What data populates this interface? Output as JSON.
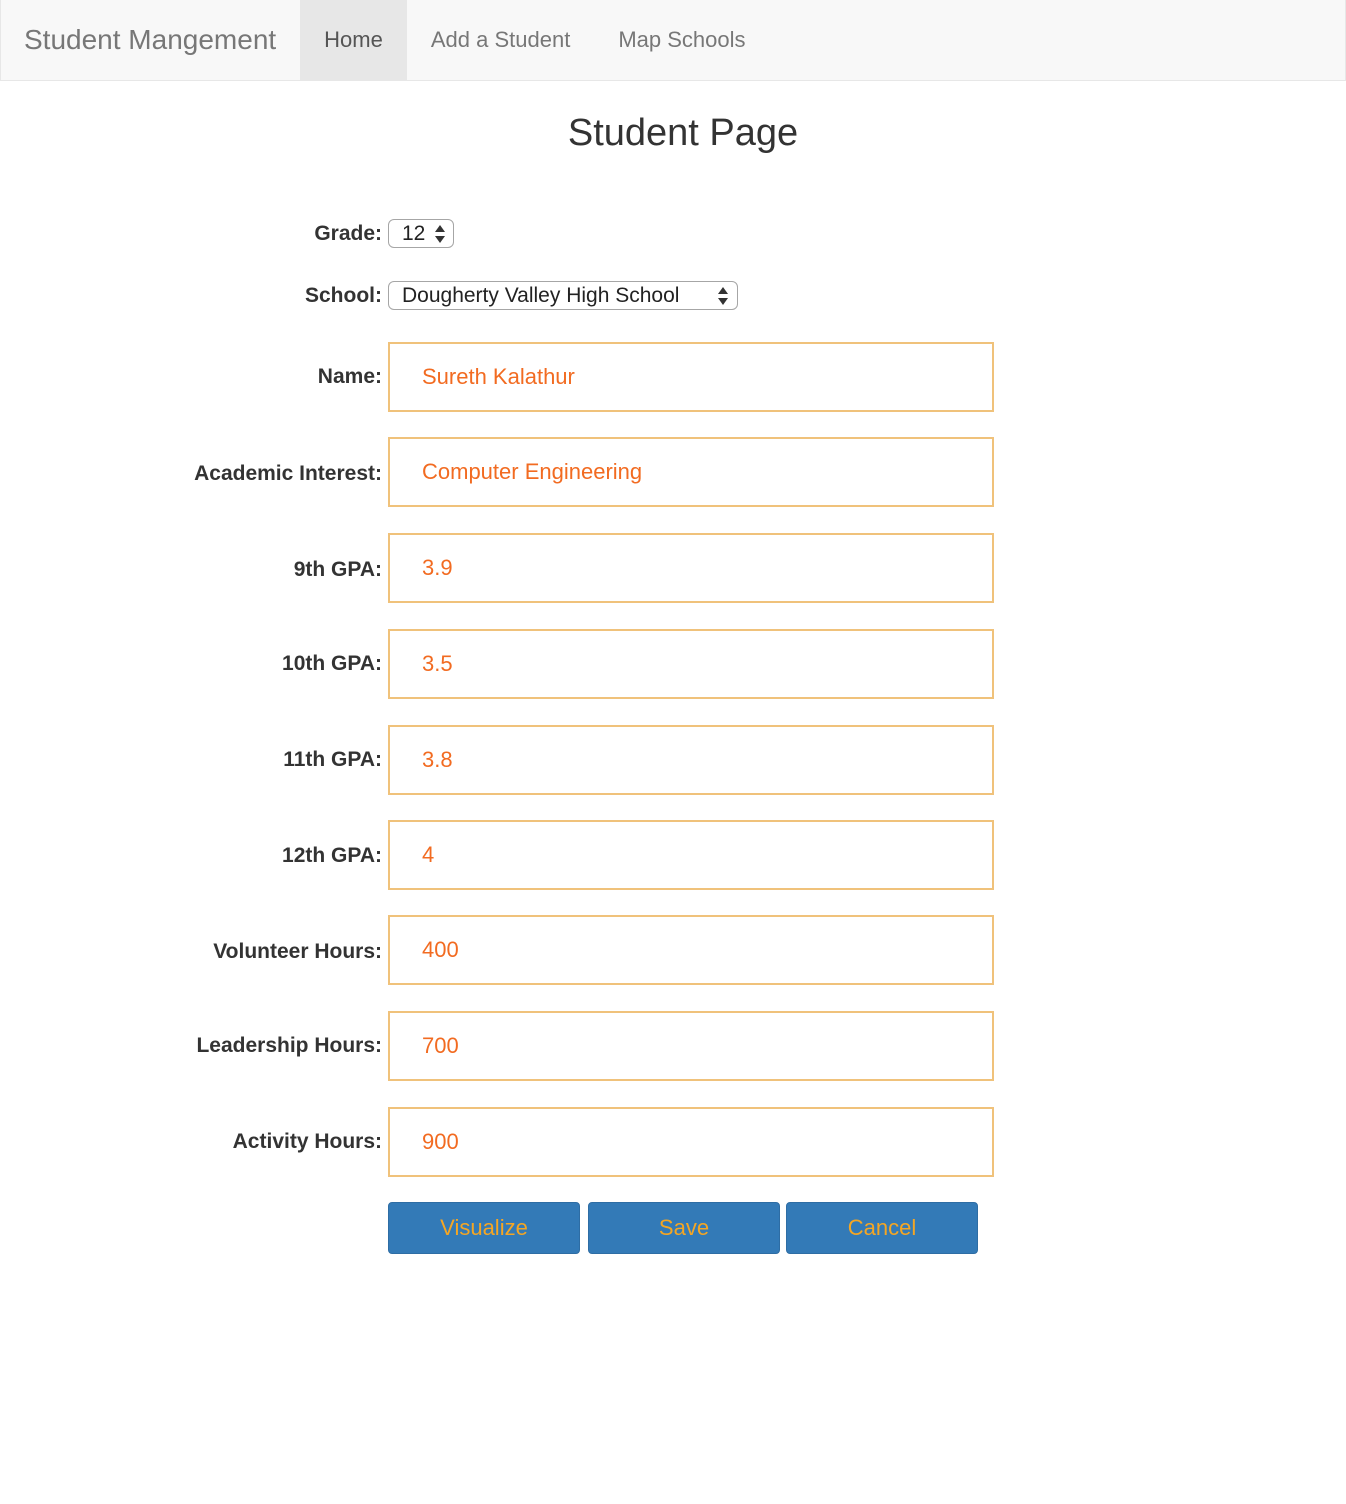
{
  "navbar": {
    "brand": "Student Mangement",
    "items": [
      {
        "label": "Home",
        "active": true
      },
      {
        "label": "Add a Student",
        "active": false
      },
      {
        "label": "Map Schools",
        "active": false
      }
    ]
  },
  "page": {
    "title": "Student Page"
  },
  "form": {
    "grade": {
      "label": "Grade:",
      "value": "12"
    },
    "school": {
      "label": "School:",
      "value": "Dougherty Valley High School"
    },
    "name": {
      "label": "Name:",
      "value": "Sureth Kalathur"
    },
    "academic_interest": {
      "label": "Academic Interest:",
      "value": "Computer Engineering"
    },
    "gpa_9": {
      "label": "9th GPA:",
      "value": "3.9"
    },
    "gpa_10": {
      "label": "10th GPA:",
      "value": "3.5"
    },
    "gpa_11": {
      "label": "11th GPA:",
      "value": "3.8"
    },
    "gpa_12": {
      "label": "12th GPA:",
      "value": "4"
    },
    "volunteer_hours": {
      "label": "Volunteer Hours:",
      "value": "400"
    },
    "leadership_hours": {
      "label": "Leadership Hours:",
      "value": "700"
    },
    "activity_hours": {
      "label": "Activity Hours:",
      "value": "900"
    }
  },
  "buttons": {
    "visualize": "Visualize",
    "save": "Save",
    "cancel": "Cancel"
  },
  "colors": {
    "input_text": "#f26b21",
    "input_border": "#f0c27b",
    "button_bg": "#337ab7",
    "button_text": "#f5a623"
  }
}
